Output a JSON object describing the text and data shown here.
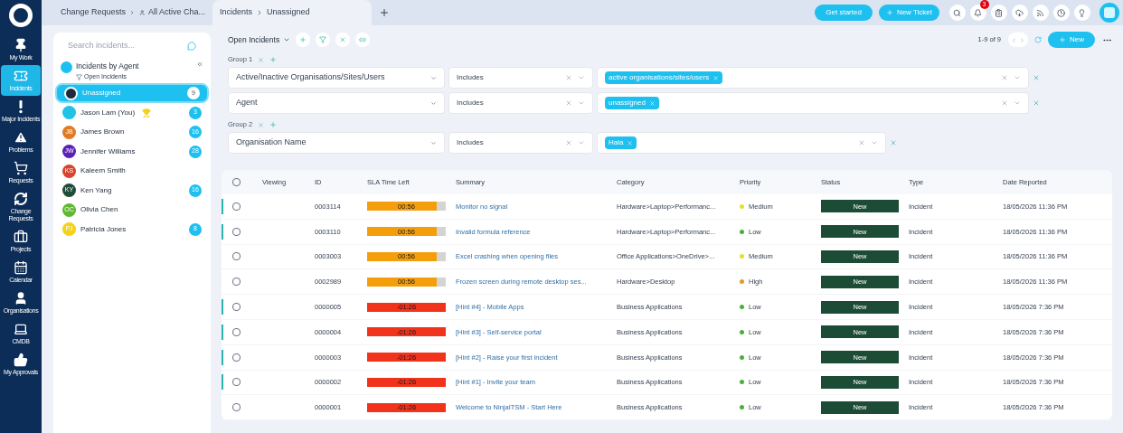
{
  "nav": [
    {
      "label": "My Work",
      "selected": false
    },
    {
      "label": "Incidents",
      "selected": true
    },
    {
      "label": "Major Incidents",
      "selected": false
    },
    {
      "label": "Problems",
      "selected": false
    },
    {
      "label": "Requests",
      "selected": false
    },
    {
      "label": "Change Requests",
      "selected": false
    },
    {
      "label": "Projects",
      "selected": false
    },
    {
      "label": "Calendar",
      "selected": false
    },
    {
      "label": "Organisations",
      "selected": false
    },
    {
      "label": "CMDB",
      "selected": false
    },
    {
      "label": "My Approvals",
      "selected": false
    }
  ],
  "tabs": [
    {
      "crumbs": [
        "Change Requests",
        "All Active Cha..."
      ],
      "selected": false
    },
    {
      "crumbs": [
        "Incidents",
        "Unassigned"
      ],
      "selected": true
    }
  ],
  "header": {
    "buttons": [
      "Get started",
      "New Ticket"
    ],
    "notification_count": "3"
  },
  "agents": {
    "search_placeholder": "Search incidents...",
    "title": "Incidents by Agent",
    "subtitle": "Open Incidents",
    "items": [
      {
        "name": "Unassigned",
        "color": "#1e293b",
        "count": "9",
        "selected": true,
        "trophy": false
      },
      {
        "name": "Jason Lam (You)",
        "color": "#22c1e6",
        "count": "3",
        "selected": false,
        "trophy": true
      },
      {
        "name": "James Brown",
        "initials": "JB",
        "color": "#e07b24",
        "count": "16",
        "selected": false,
        "trophy": false
      },
      {
        "name": "Jennifer Williams",
        "initials": "JW",
        "color": "#5b21b6",
        "count": "28",
        "selected": false,
        "trophy": false
      },
      {
        "name": "Kaleem Smith",
        "initials": "KS",
        "color": "#d9432c",
        "selected": false,
        "trophy": false
      },
      {
        "name": "Ken Yang",
        "initials": "KY",
        "color": "#1f4d3a",
        "count": "16",
        "selected": false,
        "trophy": false
      },
      {
        "name": "Olivia Chen",
        "initials": "OC",
        "color": "#62b832",
        "selected": false,
        "trophy": false
      },
      {
        "name": "Patricia Jones",
        "initials": "PJ",
        "color": "#f2d21b",
        "count": "8",
        "selected": false,
        "trophy": false
      }
    ]
  },
  "toolbar": {
    "view": "Open Incidents",
    "pagination": "1-9 of 9",
    "new_button": "New"
  },
  "filter_groups": [
    {
      "label": "Group 1",
      "filters": [
        {
          "field": "Active/Inactive Organisations/Sites/Users",
          "operator": "Includes",
          "values": [
            "active organisations/sites/users"
          ]
        },
        {
          "field": "Agent",
          "operator": "Includes",
          "values": [
            "unassigned"
          ]
        }
      ]
    },
    {
      "label": "Group 2",
      "filters": [
        {
          "field": "Organisation Name",
          "operator": "Includes",
          "values": [
            "Hala"
          ]
        }
      ]
    }
  ],
  "table": {
    "all_checked": false,
    "columns": [
      "Viewing",
      "ID",
      "SLA Time Left",
      "Summary",
      "Category",
      "Priority",
      "Status",
      "Type",
      "Date Reported"
    ],
    "rows": [
      {
        "checked": false,
        "marked": true,
        "id": "0003114",
        "sla": "00:56",
        "kind": "due",
        "summary": "Monitor no signal",
        "category": "Hardware>Laptop>Performanc...",
        "priority": "Medium",
        "color": "#e5e02a",
        "status": "New",
        "type": "Incident",
        "date": "18/05/2026 11:36 PM"
      },
      {
        "checked": false,
        "marked": true,
        "id": "0003110",
        "sla": "00:56",
        "kind": "due",
        "summary": "Invalid formula reference",
        "category": "Hardware>Laptop>Performanc...",
        "priority": "Low",
        "color": "#4cae3a",
        "status": "New",
        "type": "Incident",
        "date": "18/05/2026 11:36 PM"
      },
      {
        "checked": false,
        "marked": false,
        "id": "0003003",
        "sla": "00:56",
        "kind": "due",
        "summary": "Excel crashing when opening files",
        "category": "Office Applications>OneDrive>...",
        "priority": "Medium",
        "color": "#e5e02a",
        "status": "New",
        "type": "Incident",
        "date": "18/05/2026 11:36 PM"
      },
      {
        "checked": false,
        "marked": false,
        "id": "0002989",
        "sla": "00:56",
        "kind": "due",
        "summary": "Frozen screen during remote desktop ses...",
        "category": "Hardware>Desktop",
        "priority": "High",
        "color": "#e8962e",
        "status": "New",
        "type": "Incident",
        "date": "18/05/2026 11:36 PM"
      },
      {
        "checked": false,
        "marked": true,
        "id": "0000005",
        "sla": "-01:26",
        "kind": "overdue",
        "summary": "[Hint #4] - Mobile Apps",
        "category": "Business Applications",
        "priority": "Low",
        "color": "#4cae3a",
        "status": "New",
        "type": "Incident",
        "date": "18/05/2026 7:36 PM"
      },
      {
        "checked": false,
        "marked": true,
        "id": "0000004",
        "sla": "-01:26",
        "kind": "overdue",
        "summary": "[Hint #3] - Self-service portal",
        "category": "Business Applications",
        "priority": "Low",
        "color": "#4cae3a",
        "status": "New",
        "type": "Incident",
        "date": "18/05/2026 7:36 PM"
      },
      {
        "checked": false,
        "marked": true,
        "id": "0000003",
        "sla": "-01:26",
        "kind": "overdue",
        "summary": "[Hint #2] - Raise your first incident",
        "category": "Business Applications",
        "priority": "Low",
        "color": "#4cae3a",
        "status": "New",
        "type": "Incident",
        "date": "18/05/2026 7:36 PM"
      },
      {
        "checked": false,
        "marked": true,
        "id": "0000002",
        "sla": "-01:26",
        "kind": "overdue",
        "summary": "[Hint #1] - Invite your team",
        "category": "Business Applications",
        "priority": "Low",
        "color": "#4cae3a",
        "status": "New",
        "type": "Incident",
        "date": "18/05/2026 7:36 PM"
      },
      {
        "checked": false,
        "marked": false,
        "id": "0000001",
        "sla": "-01:26",
        "kind": "overdue",
        "summary": "Welcome to NinjaITSM - Start Here",
        "category": "Business Applications",
        "priority": "Low",
        "color": "#4cae3a",
        "status": "New",
        "type": "Incident",
        "date": "18/05/2026 7:36 PM"
      }
    ]
  }
}
